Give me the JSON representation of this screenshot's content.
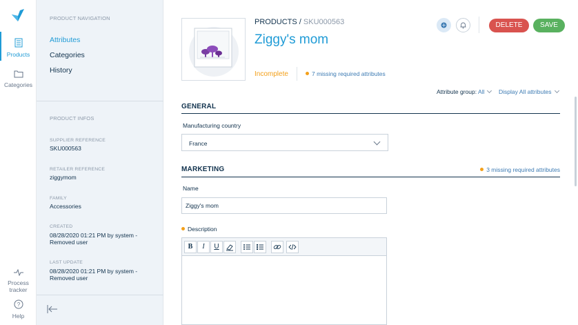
{
  "rail": {
    "products_label": "Products",
    "categories_label": "Categories",
    "process_tracker_label": "Process tracker",
    "help_label": "Help"
  },
  "panel": {
    "nav_title": "PRODUCT NAVIGATION",
    "nav_items": [
      "Attributes",
      "Categories",
      "History"
    ],
    "infos_title": "PRODUCT INFOS",
    "supplier_label": "SUPPLIER REFERENCE",
    "supplier_value": "SKU000563",
    "retailer_label": "RETAILER REFERENCE",
    "retailer_value": "ziggymom",
    "family_label": "FAMILY",
    "family_value": "Accessories",
    "created_label": "CREATED",
    "created_value": "08/28/2020 01:21 PM by system - Removed user",
    "update_label": "LAST UPDATE",
    "update_value": "08/28/2020 01:21 PM by system - Removed user"
  },
  "header": {
    "breadcrumb_root": "PRODUCTS",
    "breadcrumb_sep": " / ",
    "breadcrumb_sku": "SKU000563",
    "title": "Ziggy's mom",
    "status": "Incomplete",
    "missing": "7 missing required attributes",
    "delete_label": "DELETE",
    "save_label": "SAVE"
  },
  "filters": {
    "attr_group_label": "Attribute group:",
    "attr_group_value": "All",
    "display_value": "Display All attributes"
  },
  "general": {
    "title": "GENERAL",
    "country_label": "Manufacturing country",
    "country_value": "France"
  },
  "marketing": {
    "title": "MARKETING",
    "missing": "3 missing required attributes",
    "name_label": "Name",
    "name_value": "Ziggy's mom",
    "description_label": "Description"
  },
  "toolbar": {
    "bold": "B",
    "italic": "I",
    "underline": "U"
  },
  "colors": {
    "accent": "#1f9bd6",
    "incomplete": "#f3a01b",
    "delete": "#d9534f",
    "save": "#59b15f",
    "panel_bg": "#eef3f8"
  }
}
